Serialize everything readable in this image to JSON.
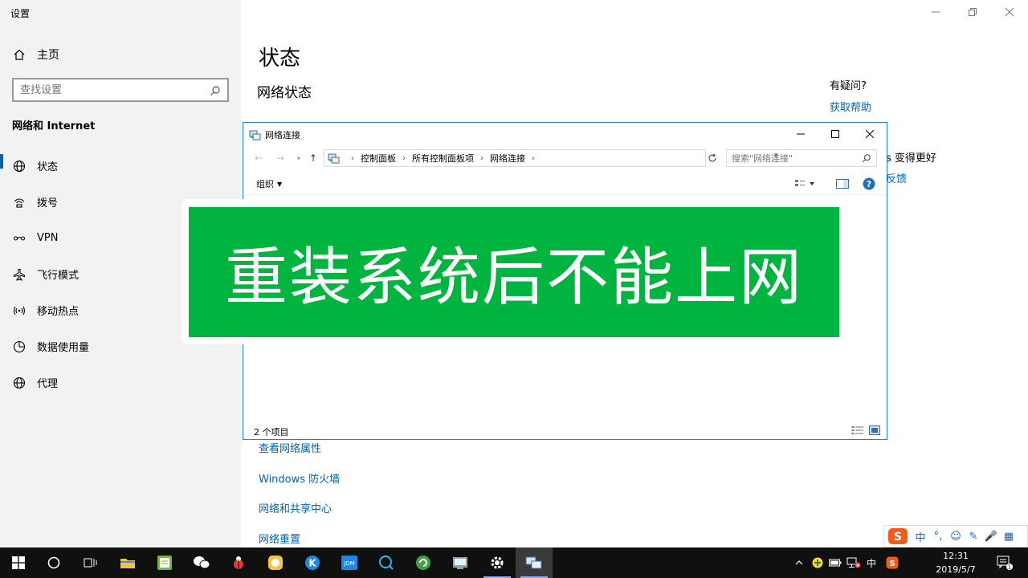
{
  "settings": {
    "app_title": "设置",
    "home_label": "主页",
    "search_placeholder": "查找设置",
    "section_title": "网络和 Internet",
    "nav_items": [
      {
        "label": "状态",
        "icon": "globe-icon"
      },
      {
        "label": "拨号",
        "icon": "dialup-icon"
      },
      {
        "label": "VPN",
        "icon": "vpn-icon"
      },
      {
        "label": "飞行模式",
        "icon": "airplane-icon"
      },
      {
        "label": "移动热点",
        "icon": "hotspot-icon"
      },
      {
        "label": "数据使用量",
        "icon": "data-usage-icon"
      },
      {
        "label": "代理",
        "icon": "globe-icon"
      }
    ],
    "page_title": "状态",
    "sub_title": "网络状态",
    "help_question": "有疑问?",
    "help_link": "获取帮助",
    "better_text": "s 变得更好",
    "feedback_link": "反馈",
    "links": [
      "查看网络属性",
      "Windows 防火墙",
      "网络和共享中心",
      "网络重置"
    ]
  },
  "explorer": {
    "title": "网络连接",
    "breadcrumb": [
      "控制面板",
      "所有控制面板项",
      "网络连接"
    ],
    "search_placeholder": "搜索\"网络连接\"",
    "organize_label": "组织",
    "status_text": "2 个项目"
  },
  "banner": {
    "text": "重装系统后不能上网",
    "color": "#00b53f"
  },
  "ime": {
    "items": [
      "中",
      "°,",
      "☺",
      "✎",
      "🎤",
      "▦"
    ]
  },
  "taskbar": {
    "time": "12:31",
    "date": "2019/5/7",
    "tray_ime": "中",
    "notification_count": "1"
  },
  "colors": {
    "accent": "#0063b1",
    "taskbar": "#101010",
    "sidebar": "#f2f2f2"
  }
}
